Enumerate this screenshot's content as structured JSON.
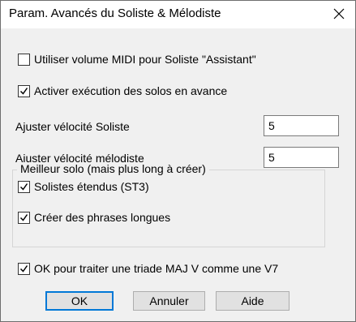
{
  "dialog": {
    "title": "Param. Avancés du Soliste & Mélodiste",
    "close_label": "close"
  },
  "options": {
    "use_midi_volume": {
      "label": "Utiliser volume MIDI pour Soliste \"Assistant\"",
      "checked": false
    },
    "early_solo": {
      "label": "Activer exécution des solos en avance",
      "checked": true
    },
    "triad_v7": {
      "label": "OK pour traiter une triade MAJ V comme une V7",
      "checked": true
    }
  },
  "velocity": {
    "soloist_label": "Ajuster vélocité Soliste",
    "soloist_value": "5",
    "melodist_label": "Ajuster vélocité mélodiste",
    "melodist_value": "5"
  },
  "better_solo_group": {
    "caption": "Meilleur solo (mais plus long à créer)",
    "extended_soloists": {
      "label": "Solistes étendus (ST3)",
      "checked": true
    },
    "long_phrases": {
      "label": "Créer des phrases longues",
      "checked": true
    }
  },
  "buttons": {
    "ok": "OK",
    "cancel": "Annuler",
    "help": "Aide"
  },
  "colors": {
    "dialog_bg": "#f0f0f0",
    "titlebar_bg": "#ffffff",
    "default_button_border": "#0078d7",
    "button_bg": "#e1e1e1"
  }
}
